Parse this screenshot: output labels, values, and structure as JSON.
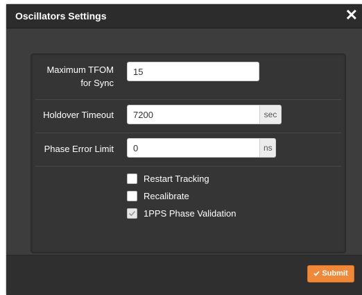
{
  "dialog": {
    "title": "Oscillators Settings",
    "close_glyph": "✕"
  },
  "fields": {
    "max_tfom": {
      "label_line1": "Maximum TFOM",
      "label_line2": "for Sync",
      "value": "15"
    },
    "holdover": {
      "label": "Holdover Timeout",
      "value": "7200",
      "unit": "sec"
    },
    "phase_error": {
      "label": "Phase Error Limit",
      "value": "0",
      "unit": "ns"
    }
  },
  "checkboxes": {
    "restart_tracking": {
      "label": "Restart Tracking",
      "checked": false
    },
    "recalibrate": {
      "label": "Recalibrate",
      "checked": false
    },
    "pps_validation": {
      "label": "1PPS Phase Validation",
      "checked": true
    }
  },
  "footer": {
    "submit_label": "Submit"
  },
  "colors": {
    "submit_bg": "#f0883a",
    "header_bg": "#2c2c2c",
    "body_bg": "#3d3d3d"
  }
}
